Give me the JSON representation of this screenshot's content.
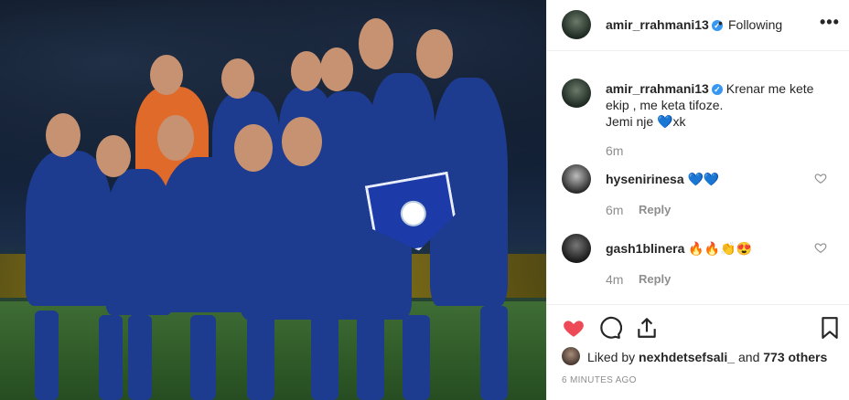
{
  "post": {
    "username": "amir_rrahmani13",
    "separator": "•",
    "follow_status": "Following",
    "more_label": "•••",
    "image_alt": "Team photo of Kosovo national football team players in blue kits"
  },
  "caption": {
    "username": "amir_rrahmani13",
    "text_line1": "Krenar me kete",
    "text_line2": "ekip , me keta tifoze.",
    "text_line3_prefix": "Jemi nje",
    "text_line3_suffix": "xk",
    "time": "6m"
  },
  "comments": [
    {
      "username": "hyseni‍rinesa",
      "display_user": "hyseni​rinesa",
      "text": "💙💙",
      "time": "6m",
      "reply_label": "Reply"
    },
    {
      "username": "gash1blinera",
      "display_user": "gash1blinera",
      "text": "🔥🔥👏😍",
      "time": "4m",
      "reply_label": "Reply"
    }
  ],
  "likes": {
    "prefix": "Liked by",
    "user": "nexhdetsefsali_",
    "suffix": "and",
    "count": "773 others"
  },
  "timestamp": "6 MINUTES AGO",
  "icons": {
    "like": "heart-icon",
    "comment": "comment-icon",
    "share": "share-icon",
    "save": "bookmark-icon",
    "verified": "verified-badge-icon"
  },
  "colors": {
    "like_red": "#ed4956",
    "verified_blue": "#3897f0",
    "meta_gray": "#8e8e8e"
  }
}
